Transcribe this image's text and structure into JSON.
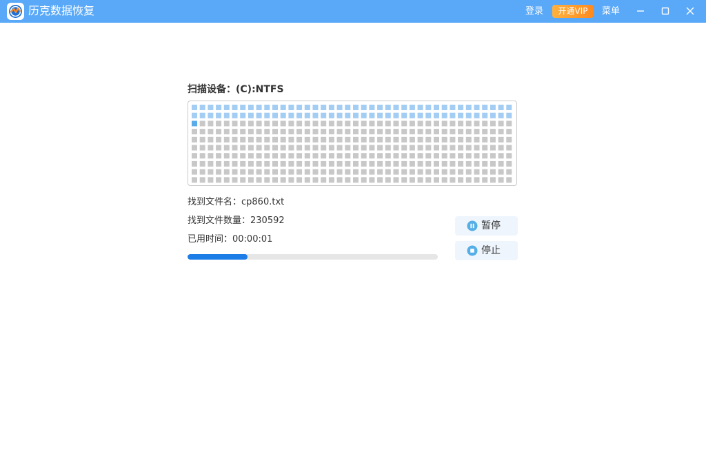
{
  "app": {
    "title": "历克数据恢复",
    "logo_icon": "recovery-logo-icon"
  },
  "titlebar": {
    "login_label": "登录",
    "vip_label": "开通VIP",
    "menu_label": "菜单",
    "window_controls": [
      "minimize-icon",
      "maximize-icon",
      "close-icon"
    ]
  },
  "scan": {
    "title": "扫描设备：(C):NTFS",
    "found_file_line": "找到文件名：cp860.txt",
    "found_count_line": "找到文件数量：230592",
    "elapsed_line": "已用时间：00:00:01",
    "progress_fraction": 0.24
  },
  "block_map": {
    "columns": 40,
    "rows": 10,
    "scanned_blocks": 80,
    "current_block": 80
  },
  "buttons": {
    "pause_label": "暂停",
    "stop_label": "停止"
  },
  "colors": {
    "titlebar": "#5aa9f8",
    "block_scanned": "#a3cdf3",
    "block_current": "#5aace8",
    "block_pending": "#c8c8c8",
    "progress_fill": "#1d7de6",
    "progress_track": "#e6e6e6",
    "vip_badge": "#ff9a2a",
    "button_icon": "#56aee6"
  }
}
